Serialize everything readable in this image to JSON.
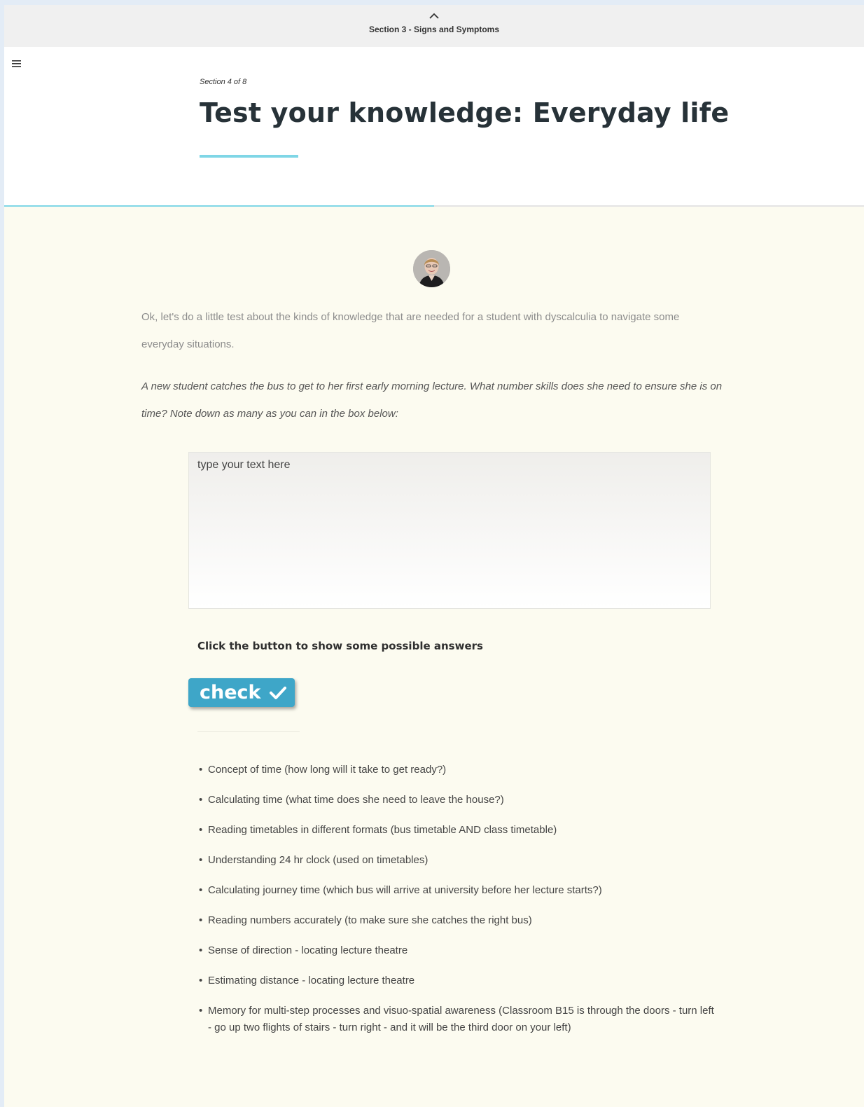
{
  "topbar": {
    "previous_section": "Section 3 - Signs and Symptoms"
  },
  "header": {
    "section_count": "Section 4 of 8",
    "title": "Test your knowledge: Everyday life",
    "progress_fraction": 0.5
  },
  "content": {
    "intro": "Ok, let's do a little test about the kinds of knowledge that are needed for a student with dyscalculia to navigate some everyday situations.",
    "question": "A new student catches the bus to get to her first early morning lecture.  What number skills does she need to ensure she is on time? Note down as many as you can in the box below:",
    "answer_placeholder": "type your text here",
    "hint": "Click the button to show some possible answers",
    "check_label": "check",
    "answers": [
      "Concept of time (how long will it take to get ready?)",
      "Calculating time (what time does she need to leave the house?)",
      "Reading timetables in different formats (bus timetable AND class timetable)",
      "Understanding 24 hr clock (used on timetables)",
      "Calculating journey time (which bus will arrive at university before her lecture starts?)",
      "Reading numbers accurately (to make sure she catches the right bus)",
      "Sense of direction - locating lecture theatre",
      "Estimating distance - locating lecture theatre",
      "Memory for multi-step processes and visuo-spatial awareness (Classroom B15 is through the doors - turn left - go up two flights of stairs - turn right - and it will be the third door on your left)"
    ]
  },
  "colors": {
    "accent": "#7fd6e6",
    "button": "#3ea6c8",
    "content_bg": "#fcfbf0"
  },
  "icons": {
    "menu": "hamburger-menu-icon",
    "previous": "chevron-up-icon",
    "check": "checkmark-icon"
  }
}
